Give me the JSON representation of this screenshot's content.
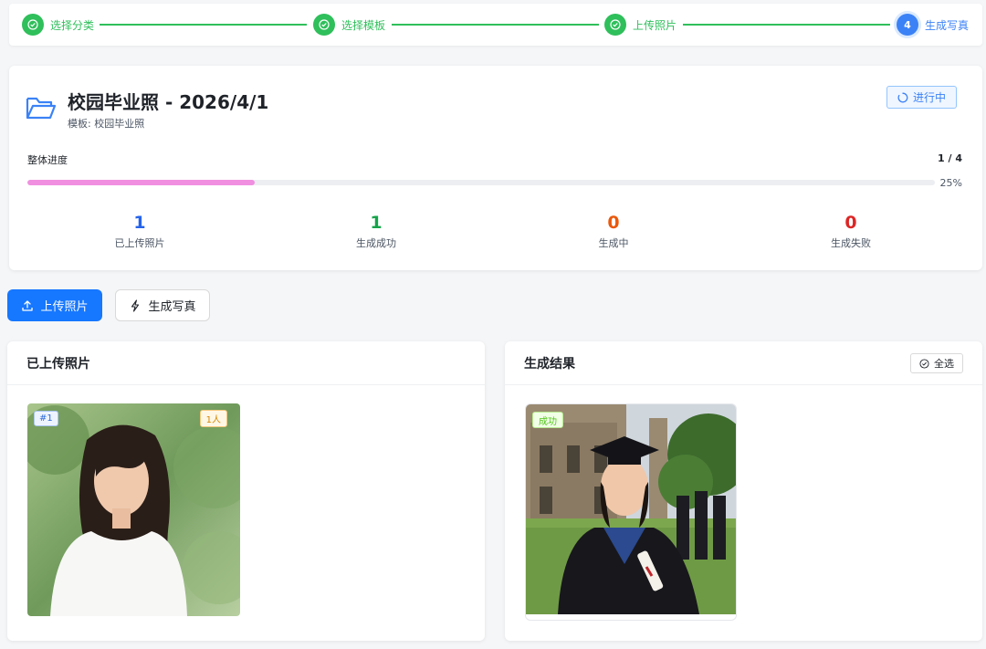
{
  "steps": [
    {
      "label": "选择分类",
      "status": "done"
    },
    {
      "label": "选择模板",
      "status": "done"
    },
    {
      "label": "上传照片",
      "status": "done"
    },
    {
      "label": "生成写真",
      "status": "active",
      "number": "4"
    }
  ],
  "project": {
    "title": "校园毕业照 - 2026/4/1",
    "template": "模板: 校园毕业照",
    "status": "进行中",
    "progress_label": "整体进度",
    "progress_count": "1 / 4",
    "progress_percent_text": "25%",
    "progress_fraction": 0.25,
    "stats": [
      {
        "value": "1",
        "label": "已上传照片",
        "color": "#2563eb"
      },
      {
        "value": "1",
        "label": "生成成功",
        "color": "#16a34a"
      },
      {
        "value": "0",
        "label": "生成中",
        "color": "#ea580c"
      },
      {
        "value": "0",
        "label": "生成失败",
        "color": "#dc2626"
      }
    ]
  },
  "actions": {
    "upload_label": "上传照片",
    "generate_label": "生成写真"
  },
  "uploaded_panel": {
    "title": "已上传照片",
    "photos": [
      {
        "index_tag": "#1",
        "people_tag": "1人"
      }
    ]
  },
  "results_panel": {
    "title": "生成结果",
    "select_all_label": "全选",
    "results": [
      {
        "status_tag": "成功"
      }
    ]
  },
  "colors": {
    "primary": "#1677ff",
    "step_done": "#2fbf5b",
    "step_active": "#3b82f6",
    "progress_fill": "#f08fe0"
  },
  "icons": {
    "step_done": "check-circle-icon",
    "folder": "folder-open-icon",
    "status": "loading-icon",
    "upload": "upload-icon",
    "generate": "lightning-icon",
    "select_all": "check-circle-icon"
  }
}
